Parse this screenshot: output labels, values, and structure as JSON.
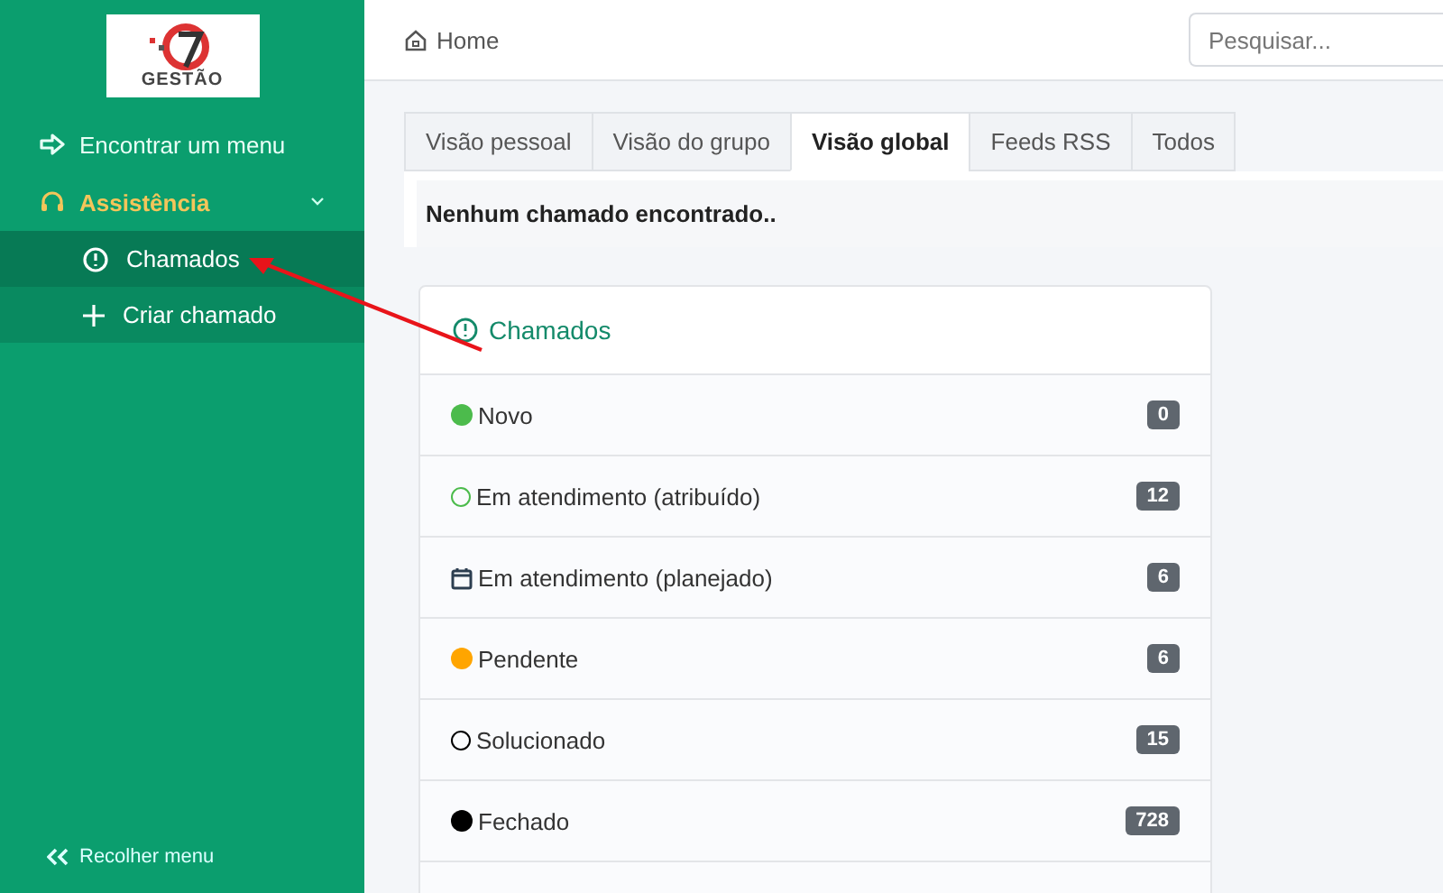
{
  "sidebar": {
    "logo_text": "GESTÃO",
    "items": [
      {
        "label": "Encontrar um menu",
        "kind": "arrow",
        "expanded": false
      },
      {
        "label": "Assistência",
        "kind": "headset",
        "expanded": true,
        "children": [
          {
            "label": "Chamados",
            "kind": "alert",
            "selected": true
          },
          {
            "label": "Criar chamado",
            "kind": "plus",
            "selected": false
          }
        ]
      }
    ],
    "collapse_label": "Recolher menu"
  },
  "header": {
    "breadcrumb": "Home",
    "search": {
      "placeholder": "Pesquisar..."
    }
  },
  "tabs": [
    {
      "label": "Visão pessoal",
      "selected": false
    },
    {
      "label": "Visão do grupo",
      "selected": false
    },
    {
      "label": "Visão global",
      "selected": true
    },
    {
      "label": "Feeds RSS",
      "selected": false
    },
    {
      "label": "Todos",
      "selected": false
    }
  ],
  "message": "Nenhum chamado encontrado..",
  "card": {
    "title": "Chamados",
    "rows": [
      {
        "kind": "dot",
        "color": "#4cbb4c",
        "label": "Novo",
        "count": "0"
      },
      {
        "kind": "ring",
        "color": "#4cbb4c",
        "label": "Em atendimento (atribuído)",
        "count": "12"
      },
      {
        "kind": "calendar",
        "color": "#2c3e50",
        "label": "Em atendimento (planejado)",
        "count": "6"
      },
      {
        "kind": "dot",
        "color": "#ffa500",
        "label": "Pendente",
        "count": "6"
      },
      {
        "kind": "ring",
        "color": "#000000",
        "label": "Solucionado",
        "count": "15"
      },
      {
        "kind": "dot",
        "color": "#000000",
        "label": "Fechado",
        "count": "728"
      }
    ]
  }
}
